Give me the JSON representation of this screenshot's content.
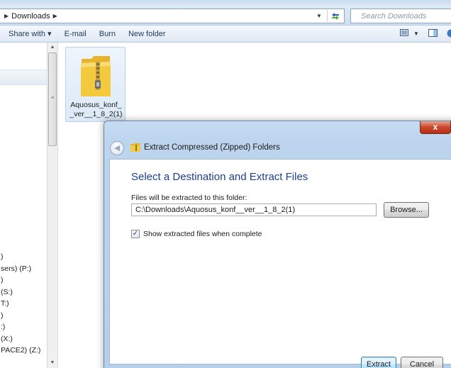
{
  "explorer": {
    "address": {
      "current_folder": "Downloads",
      "search_placeholder": "Search Downloads"
    },
    "toolbar": {
      "share_with": "Share with ▾",
      "email": "E-mail",
      "burn": "Burn",
      "new_folder": "New folder"
    },
    "nav_drives": [
      ")",
      "sers) (P:)",
      ")",
      "(S:)",
      "T:)",
      ")",
      ":)",
      "(X:)",
      "PACE2) (Z:)"
    ],
    "file": {
      "name": "Aquosus_konf__ver__1_8_2(1)",
      "icon": "zipped-folder-icon"
    }
  },
  "dialog": {
    "title": "Extract Compressed (Zipped) Folders",
    "heading": "Select a Destination and Extract Files",
    "folder_label": "Files will be extracted to this folder:",
    "path_value": "C:\\Downloads\\Aquosus_konf__ver__1_8_2(1)",
    "browse_label": "Browse...",
    "show_files_label": "Show extracted files when complete",
    "show_files_checked": true,
    "extract_label": "Extract",
    "cancel_label": "Cancel",
    "close_glyph": "x"
  },
  "colors": {
    "heading_blue": "#1e3f8a",
    "dialog_frame": "#bcd4ee",
    "close_red": "#c9462c",
    "folder_yellow": "#f3c93e"
  }
}
